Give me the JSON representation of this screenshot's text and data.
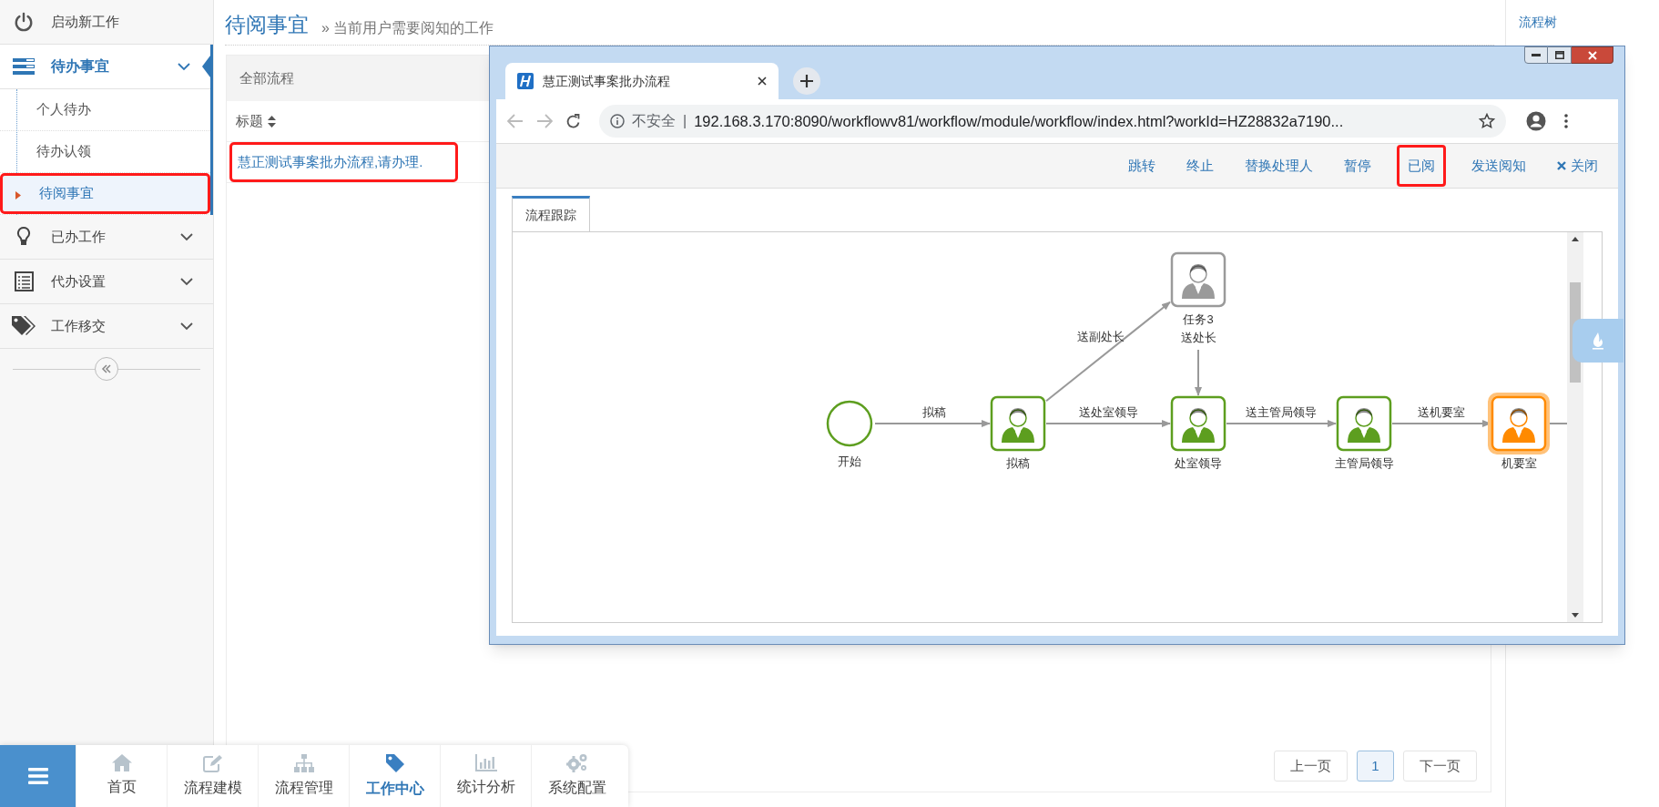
{
  "sidebar": {
    "items": [
      {
        "kind": "link",
        "label": "启动新工作",
        "active": false
      },
      {
        "kind": "group",
        "label": "待办事宜",
        "active": true,
        "children": [
          {
            "label": "个人待办",
            "selected": false,
            "highlighted": false
          },
          {
            "label": "待办认领",
            "selected": false,
            "highlighted": false
          },
          {
            "label": "待阅事宜",
            "selected": true,
            "highlighted": true
          }
        ]
      },
      {
        "kind": "group",
        "label": "已办工作",
        "active": false
      },
      {
        "kind": "group",
        "label": "代办设置",
        "active": false
      },
      {
        "kind": "group",
        "label": "工作移交",
        "active": false
      }
    ]
  },
  "page": {
    "title": "待阅事宜",
    "subtitle": "» 当前用户需要阅知的工作"
  },
  "list": {
    "heading": "全部流程",
    "columns": [
      {
        "label": "标题",
        "sortable": true
      }
    ],
    "rows": [
      {
        "title": "慧正测试事案批办流程,请办理.",
        "highlighted": true
      }
    ]
  },
  "pagination": {
    "previous": "上一页",
    "pages": [
      {
        "label": "1",
        "selected": true
      }
    ],
    "next": "下一页"
  },
  "right_panel": {
    "title": "流程树"
  },
  "popup_window": {
    "tab_title": "慧正测试事案批办流程",
    "address": {
      "security": "不安全",
      "separator": "|",
      "url": "192.168.3.170:8090/workflowv81/workflow/module/workflow/index.html?workId=HZ28832a7190..."
    },
    "actions": [
      {
        "kind": "text",
        "label": "跳转",
        "highlighted": false
      },
      {
        "kind": "text",
        "label": "终止",
        "highlighted": false
      },
      {
        "kind": "text",
        "label": "替换处理人",
        "highlighted": false
      },
      {
        "kind": "text",
        "label": "暂停",
        "highlighted": false
      },
      {
        "kind": "text",
        "label": "已阅",
        "highlighted": true
      },
      {
        "kind": "text",
        "label": "发送阅知",
        "highlighted": false
      },
      {
        "kind": "close",
        "label": "关闭",
        "highlighted": false
      }
    ],
    "tabs": [
      {
        "label": "流程跟踪",
        "selected": true
      }
    ],
    "diagram": {
      "nodes": [
        {
          "kind": "task",
          "label": "任务3",
          "color": "#9a9a9a",
          "current": false
        },
        {
          "kind": "start",
          "label": "开始",
          "color": "#5d9e1f",
          "current": false
        },
        {
          "kind": "task",
          "label": "拟稿",
          "color": "#5d9e1f",
          "current": false
        },
        {
          "kind": "task",
          "label": "处室领导",
          "color": "#5d9e1f",
          "current": false
        },
        {
          "kind": "task",
          "label": "主管局领导",
          "color": "#5d9e1f",
          "current": false
        },
        {
          "kind": "task",
          "label": "机要室",
          "color": "#ff8a00",
          "current": true
        }
      ],
      "edges": [
        {
          "kind": "link",
          "label": "送副处长"
        },
        {
          "kind": "link",
          "label": "送处长"
        },
        {
          "kind": "link",
          "label": "拟稿"
        },
        {
          "kind": "link",
          "label": "送处室领导"
        },
        {
          "kind": "link",
          "label": "送主管局领导"
        },
        {
          "kind": "link",
          "label": "送机要室"
        },
        {
          "kind": "exit"
        }
      ]
    }
  },
  "bottom_nav": {
    "items": [
      {
        "label": "首页",
        "selected": false
      },
      {
        "label": "流程建模",
        "selected": false
      },
      {
        "label": "流程管理",
        "selected": false
      },
      {
        "label": "工作中心",
        "selected": true
      },
      {
        "label": "统计分析",
        "selected": false
      },
      {
        "label": "系统配置",
        "selected": false
      }
    ]
  }
}
